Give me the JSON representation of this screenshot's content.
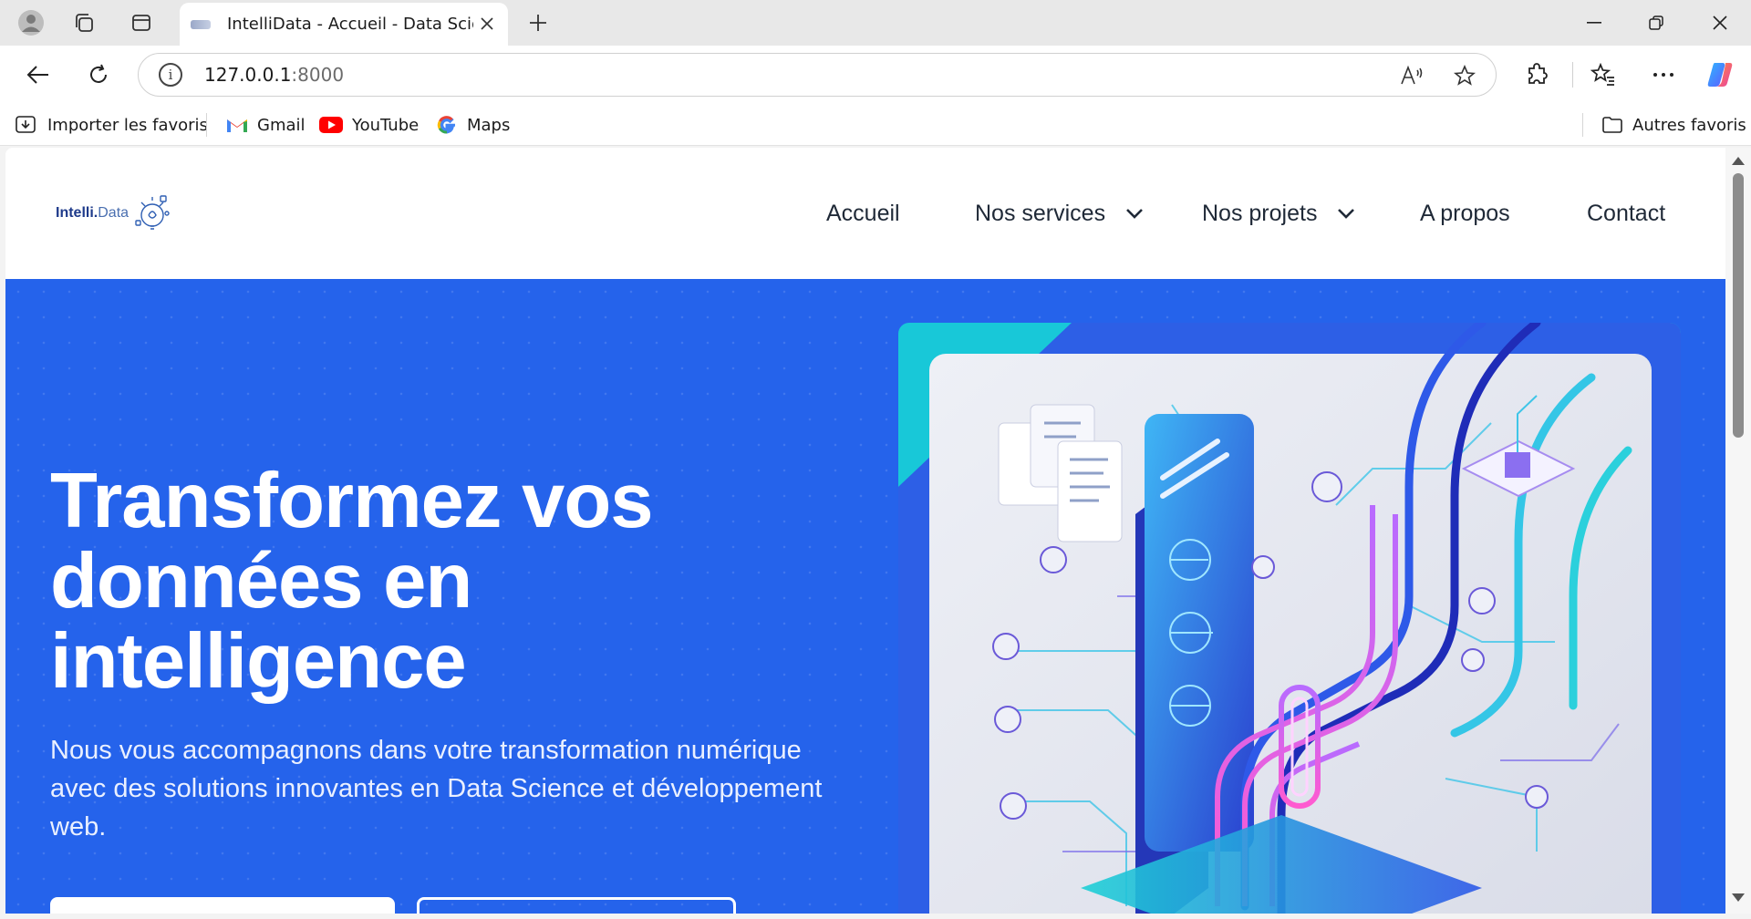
{
  "browser": {
    "tab": {
      "title": "IntelliData - Accueil - Data Science"
    },
    "address": {
      "host": "127.0.0.1",
      "port": ":8000"
    },
    "bookmarks": [
      {
        "label": "Importer les favoris",
        "icon": "import-favorites-icon"
      },
      {
        "label": "Gmail",
        "icon": "gmail-icon"
      },
      {
        "label": "YouTube",
        "icon": "youtube-icon"
      },
      {
        "label": "Maps",
        "icon": "google-maps-icon"
      }
    ],
    "other_favorites": "Autres favoris"
  },
  "site": {
    "logo": {
      "part1": "Intelli.",
      "part2": "Data"
    },
    "nav": [
      {
        "label": "Accueil"
      },
      {
        "label": "Nos services",
        "dropdown": true
      },
      {
        "label": "Nos projets",
        "dropdown": true
      },
      {
        "label": "A propos"
      },
      {
        "label": "Contact"
      }
    ],
    "hero": {
      "title": "Transformez vos données en intelligence",
      "subtitle": "Nous vous accompagnons dans votre transformation numérique avec des solutions innovantes en Data Science et développement web."
    }
  },
  "colors": {
    "hero_bg": "#2563eb",
    "nav_text": "#1f2937",
    "logo_dark": "#1e3a8a"
  }
}
